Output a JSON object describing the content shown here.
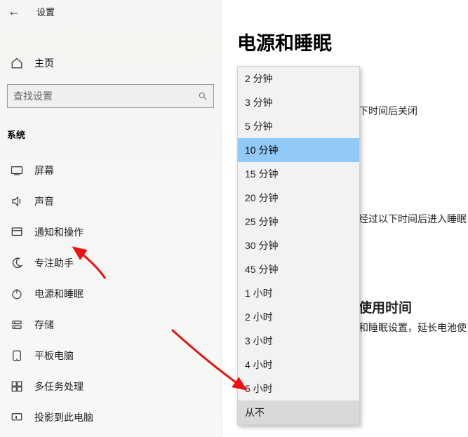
{
  "header": {
    "back_glyph": "←",
    "title": "设置"
  },
  "home": {
    "label": "主页"
  },
  "search": {
    "placeholder": "查找设置"
  },
  "group_header": "系统",
  "nav": {
    "items": [
      {
        "label": "屏幕"
      },
      {
        "label": "声音"
      },
      {
        "label": "通知和操作"
      },
      {
        "label": "专注助手"
      },
      {
        "label": "电源和睡眠"
      },
      {
        "label": "存储"
      },
      {
        "label": "平板电脑"
      },
      {
        "label": "多任务处理"
      },
      {
        "label": "投影到此电脑"
      }
    ]
  },
  "page": {
    "title": "电源和睡眠",
    "hint1": "下时间后关闭",
    "hint2": "经过以下时间后进入睡眠",
    "section_h": "使用时间",
    "section_sub": "和睡眠设置，延长电池使"
  },
  "dropdown": {
    "selected_index": 3,
    "hover_index": 14,
    "options": [
      "2 分钟",
      "3 分钟",
      "5 分钟",
      "10 分钟",
      "15 分钟",
      "20 分钟",
      "25 分钟",
      "30 分钟",
      "45 分钟",
      "1 小时",
      "2 小时",
      "3 小时",
      "4 小时",
      "5 小时",
      "从不"
    ]
  }
}
